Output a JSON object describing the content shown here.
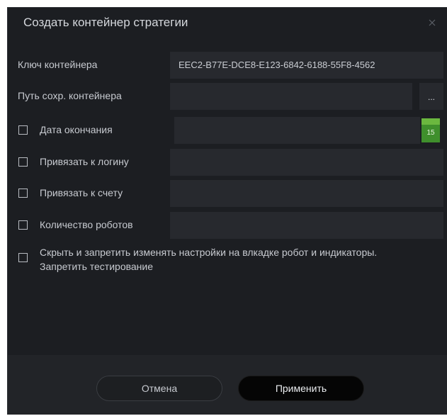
{
  "dialog": {
    "title": "Создать контейнер стратегии"
  },
  "fields": {
    "container_key": {
      "label": "Ключ контейнера",
      "value": "EEC2-B77E-DCE8-E123-6842-6188-55F8-4562"
    },
    "save_path": {
      "label": "Путь сохр. контейнера",
      "value": "",
      "browse_label": "..."
    },
    "end_date": {
      "label": "Дата окончания",
      "value": "",
      "checked": false,
      "calendar_day": "15"
    },
    "bind_login": {
      "label": "Привязать к логину",
      "value": "",
      "checked": false
    },
    "bind_account": {
      "label": "Привязать к счету",
      "value": "",
      "checked": false
    },
    "robot_count": {
      "label": "Количество роботов",
      "value": "",
      "checked": false
    },
    "hide_settings": {
      "label": "Скрыть и запретить изменять настройки на влкадке робот и индикаторы. Запретить тестирование",
      "checked": false
    }
  },
  "footer": {
    "cancel_label": "Отмена",
    "apply_label": "Применить"
  },
  "colors": {
    "background": "#1c1e22",
    "field": "#27292e",
    "calendar_accent": "#3f8f2c",
    "primary_button": "#050505"
  }
}
